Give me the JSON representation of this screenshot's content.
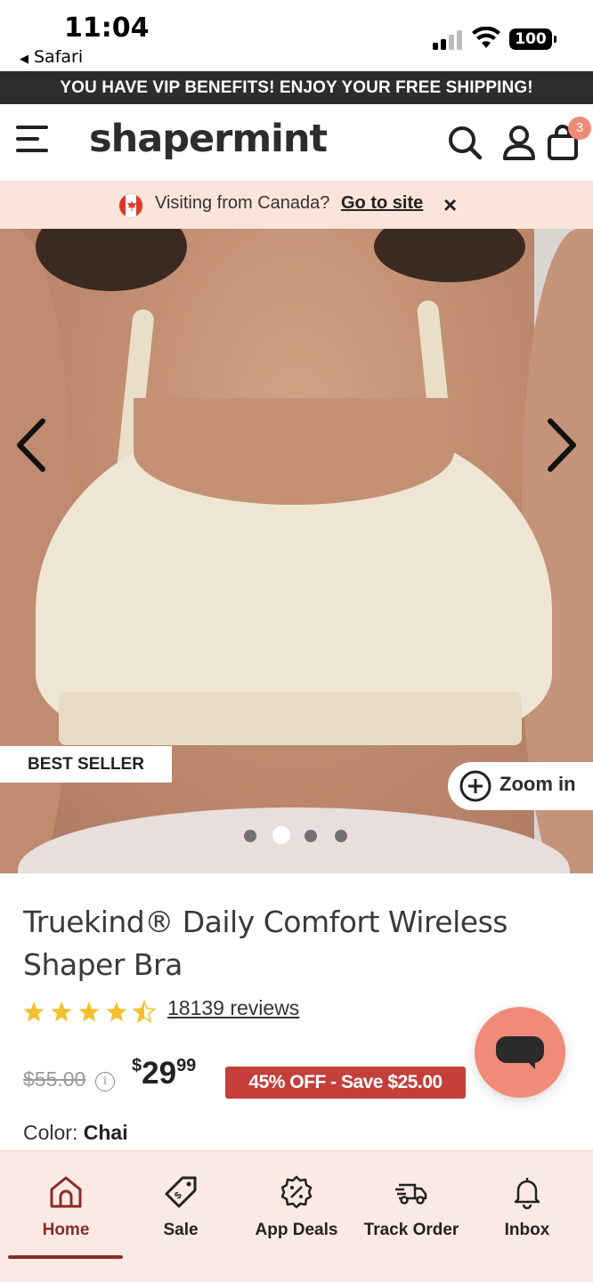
{
  "status_bar": {
    "time": "11:04",
    "back_app": "Safari",
    "battery": "100"
  },
  "promo": {
    "text": "YOU HAVE VIP BENEFITS! ENJOY YOUR FREE SHIPPING!"
  },
  "header": {
    "logo": "shapermint",
    "cart_count": "3"
  },
  "country_bar": {
    "text": "Visiting from Canada?",
    "link": "Go to site",
    "close": "×"
  },
  "gallery": {
    "badge": "BEST SELLER",
    "zoom_label": "Zoom in",
    "dots_total": 4,
    "active_dot": 2
  },
  "product": {
    "title": "Truekind® Daily Comfort Wireless Shaper Bra",
    "rating": 4.5,
    "reviews": "18139 reviews",
    "old_price": "$55.00",
    "price_currency": "$",
    "price_whole": "29",
    "price_cents": "99",
    "discount": "45% OFF - Save $25.00",
    "color_label": "Color:",
    "color_value": "Chai"
  },
  "bottom_nav": {
    "tabs": [
      {
        "label": "Home",
        "icon": "home-icon"
      },
      {
        "label": "Sale",
        "icon": "tag-icon"
      },
      {
        "label": "App Deals",
        "icon": "discount-badge-icon"
      },
      {
        "label": "Track Order",
        "icon": "truck-icon"
      },
      {
        "label": "Inbox",
        "icon": "bell-icon"
      }
    ],
    "active": "Home"
  },
  "colors": {
    "accent": "#8b2b2b",
    "promo_bg": "#2d2d2d",
    "country_bg": "#fbe5da",
    "discount_bg": "#c43e3a",
    "chat_fab": "#ef8b77",
    "star": "#f2c12e"
  }
}
